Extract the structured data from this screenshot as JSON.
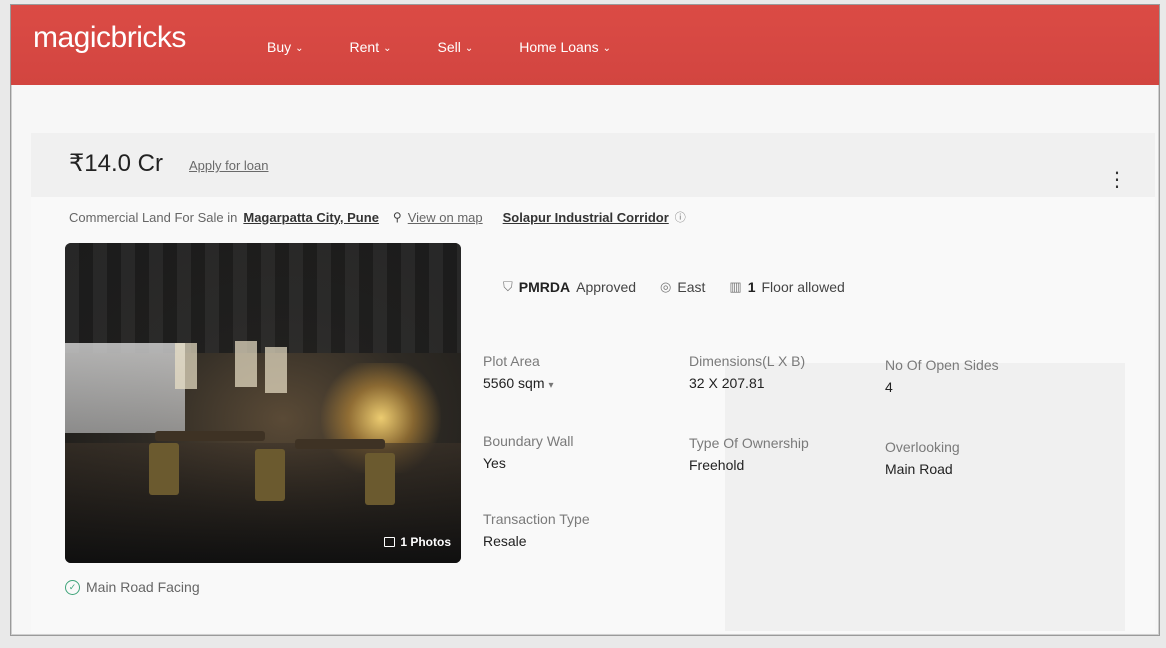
{
  "brand": {
    "logo": "magicbricks",
    "color": "#d9453f"
  },
  "nav": [
    {
      "label": "Buy"
    },
    {
      "label": "Rent"
    },
    {
      "label": "Sell"
    },
    {
      "label": "Home Loans"
    }
  ],
  "listing": {
    "price": "₹14.0 Cr",
    "apply_loan": "Apply for loan",
    "subtitle_prefix": "Commercial Land For Sale in",
    "location": "Magarpatta City, Pune",
    "view_on_map": "View on map",
    "corridor": "Solapur Industrial Corridor",
    "photo_count": "1 Photos",
    "highlights": {
      "approval_bold": "PMRDA",
      "approval_rest": "Approved",
      "facing_direction": "East",
      "floors_bold": "1",
      "floors_rest": "Floor allowed"
    },
    "specs": [
      {
        "key": "Plot Area",
        "value": "5560 sqm"
      },
      {
        "key": "Dimensions(L X B)",
        "value": "32 X 207.81"
      },
      {
        "key": "No Of Open Sides",
        "value": "4"
      },
      {
        "key": "Boundary Wall",
        "value": "Yes"
      },
      {
        "key": "Type Of Ownership",
        "value": "Freehold"
      },
      {
        "key": "Overlooking",
        "value": "Main Road"
      },
      {
        "key": "Transaction Type",
        "value": "Resale"
      }
    ],
    "feature": "Main Road Facing"
  },
  "icons": {
    "kebab": "more-vertical-icon",
    "pin": "location-pin-icon",
    "info": "info-icon",
    "shield": "shield-check-icon",
    "compass": "compass-icon",
    "building": "building-icon",
    "photo": "image-icon",
    "check": "check-circle-icon"
  }
}
